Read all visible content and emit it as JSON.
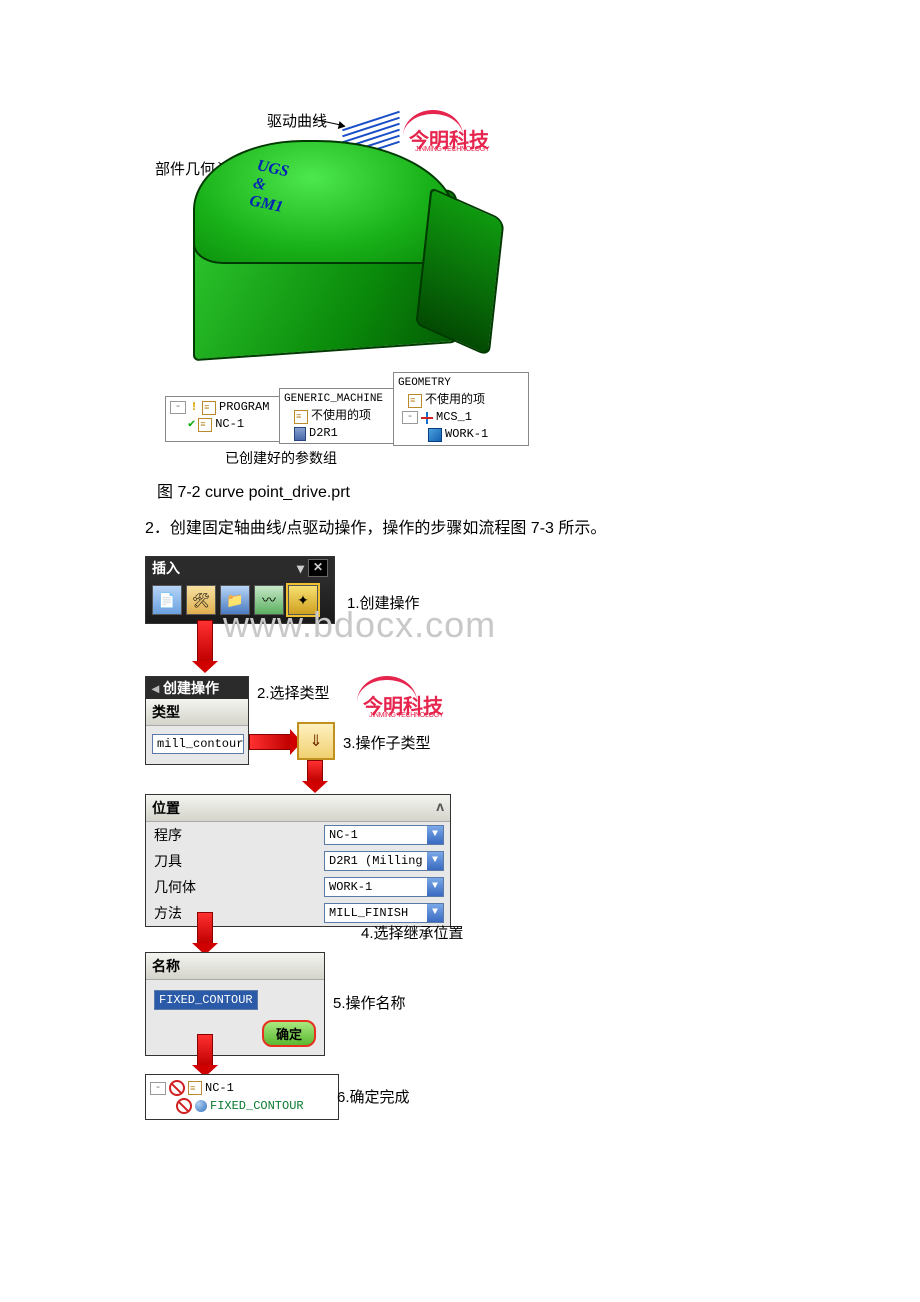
{
  "fig1": {
    "anno_drive": "驱动曲线",
    "anno_part": "部件几何",
    "ugs_text": "UGS & GM1",
    "logo_main": "今明科技",
    "logo_sub": "JINMING TECHNOLOGY",
    "tree_program": {
      "title": "",
      "r1": "PROGRAM",
      "r2": "NC-1"
    },
    "tree_machine": {
      "title": "GENERIC_MACHINE",
      "r1": "不使用的项",
      "r2": "D2R1"
    },
    "tree_geom": {
      "title": "GEOMETRY",
      "r1": "不使用的项",
      "r2": "MCS_1",
      "r3": "WORK-1"
    },
    "caption_below": "已创建好的参数组"
  },
  "text": {
    "caption": "图 7-2 curve point_drive.prt",
    "para": "2．创建固定轴曲线/点驱动操作，操作的步骤如流程图 7-3 所示。"
  },
  "flow": {
    "watermark": "www.bdocx.com",
    "insert_title": "插入",
    "step1": "1.创建操作",
    "create_title": "创建操作",
    "type_label": "类型",
    "type_value": "mill_contour",
    "step2": "2.选择类型",
    "step3": "3.操作子类型",
    "pos_title": "位置",
    "f_program": "程序",
    "v_program": "NC-1",
    "f_tool": "刀具",
    "v_tool": "D2R1 (Milling",
    "f_geom": "几何体",
    "v_geom": "WORK-1",
    "f_method": "方法",
    "v_method": "MILL_FINISH",
    "step4": "4.选择继承位置",
    "name_title": "名称",
    "name_value": "FIXED_CONTOUR",
    "ok": "确定",
    "step5": "5.操作名称",
    "tree_nc": "NC-1",
    "tree_fc": "FIXED_CONTOUR",
    "step6": "6.确定完成"
  }
}
